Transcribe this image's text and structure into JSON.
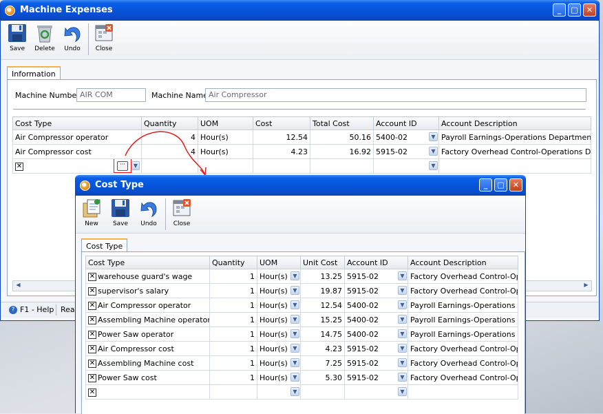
{
  "colors": {
    "title_blue": "#0553d9",
    "tab_accent": "#f2b24e",
    "annotation_red": "#e31b1b"
  },
  "main": {
    "title": "Machine Expenses",
    "toolbar": [
      {
        "label": "Save",
        "icon": "floppy-disk-icon"
      },
      {
        "label": "Delete",
        "icon": "recycle-bin-icon"
      },
      {
        "label": "Undo",
        "icon": "undo-arrow-icon"
      },
      {
        "label": "Close",
        "icon": "close-window-icon"
      }
    ],
    "tab": "Information",
    "machine_number_label": "Machine Number",
    "machine_number_value": "AIR COM",
    "machine_name_label": "Machine Name",
    "machine_name_value": "Air Compressor",
    "columns": [
      "Cost Type",
      "Quantity",
      "UOM",
      "Cost",
      "Total Cost",
      "Account ID",
      "Account Description"
    ],
    "rows": [
      [
        "Air Compressor operator",
        "4",
        "Hour(s)",
        "12.54",
        "50.16",
        "5400-02",
        "Payroll Earnings-Operations Department"
      ],
      [
        "Air Compressor cost",
        "4",
        "Hour(s)",
        "4.23",
        "16.92",
        "5915-02",
        "Factory Overhead Control-Operations Depart"
      ]
    ],
    "status_help": "F1 - Help",
    "status_text": "Rea"
  },
  "popup": {
    "title": "Cost Type",
    "toolbar": [
      {
        "label": "New",
        "icon": "new-document-icon"
      },
      {
        "label": "Save",
        "icon": "floppy-disk-icon"
      },
      {
        "label": "Undo",
        "icon": "undo-arrow-icon"
      },
      {
        "label": "Close",
        "icon": "close-window-icon"
      }
    ],
    "tab": "Cost Type",
    "columns": [
      "Cost Type",
      "Quantity",
      "UOM",
      "Unit Cost",
      "Account ID",
      "Account Description"
    ],
    "rows": [
      [
        "warehouse guard's wage",
        "1",
        "Hour(s)",
        "13.25",
        "5915-02",
        "Factory Overhead Control-Oper"
      ],
      [
        "supervisor's salary",
        "1",
        "Hour(s)",
        "19.87",
        "5915-02",
        "Factory Overhead Control-Oper"
      ],
      [
        "Air Compressor operator",
        "1",
        "Hour(s)",
        "12.54",
        "5400-02",
        "Payroll Earnings-Operations Dep"
      ],
      [
        "Assembling Machine operator",
        "1",
        "Hour(s)",
        "15.25",
        "5400-02",
        "Payroll Earnings-Operations Dep"
      ],
      [
        "Power Saw operator",
        "1",
        "Hour(s)",
        "14.75",
        "5400-02",
        "Payroll Earnings-Operations Dep"
      ],
      [
        "Air Compressor cost",
        "1",
        "Hour(s)",
        "4.23",
        "5915-02",
        "Factory Overhead Control-Oper"
      ],
      [
        "Assembling Machine cost",
        "1",
        "Hour(s)",
        "7.25",
        "5915-02",
        "Factory Overhead Control-Oper"
      ],
      [
        "Power Saw cost",
        "1",
        "Hour(s)",
        "5.30",
        "5915-02",
        "Factory Overhead Control-Oper"
      ]
    ]
  }
}
